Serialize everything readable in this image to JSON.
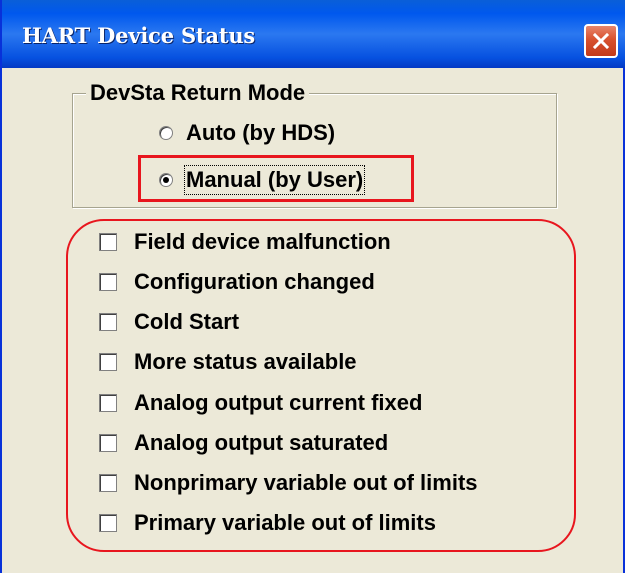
{
  "window": {
    "title": "HART Device Status",
    "close_icon": "close-x-icon"
  },
  "return_mode": {
    "legend": "DevSta Return Mode",
    "options": [
      {
        "label": "Auto (by HDS)",
        "checked": false
      },
      {
        "label": "Manual (by User)",
        "checked": true
      }
    ]
  },
  "status_flags": [
    {
      "label": "Field device malfunction",
      "checked": false
    },
    {
      "label": "Configuration changed",
      "checked": false
    },
    {
      "label": "Cold Start",
      "checked": false
    },
    {
      "label": "More status available",
      "checked": false
    },
    {
      "label": "Analog output current fixed",
      "checked": false
    },
    {
      "label": "Analog output saturated",
      "checked": false
    },
    {
      "label": "Nonprimary variable out of limits",
      "checked": false
    },
    {
      "label": "Primary variable out of limits",
      "checked": false
    }
  ],
  "colors": {
    "highlight": "#e8161e",
    "titlebar": "#0058ee",
    "dialog_bg": "#ece9d8"
  }
}
